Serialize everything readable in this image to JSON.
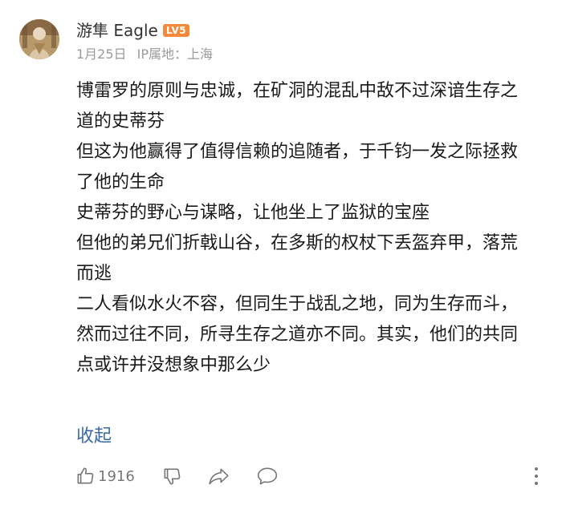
{
  "comment": {
    "username": "游隼 Eagle",
    "level_badge": "LV5",
    "date": "1月25日",
    "ip_location": "IP属地：上海",
    "paragraphs": [
      "博雷罗的原则与忠诚，在矿洞的混乱中敌不过深谙生存之道的史蒂芬",
      "但这为他赢得了值得信赖的追随者，于千钧一发之际拯救了他的生命",
      "史蒂芬的野心与谋略，让他坐上了监狱的宝座",
      "但他的弟兄们折戟山谷，在多斯的权杖下丢盔弃甲，落荒而逃",
      "二人看似水火不容，但同生于战乱之地，同为生存而斗，然而过往不同，所寻生存之道亦不同。其实，他们的共同点或许并没想象中那么少"
    ],
    "collapse_label": "收起",
    "like_count": "1916"
  },
  "icons": {
    "like": "thumbs-up-icon",
    "dislike": "thumbs-down-icon",
    "share": "share-icon",
    "reply": "comment-icon",
    "more": "more-vertical-icon"
  },
  "colors": {
    "badge": "#f5893a",
    "link": "#3b6aa0",
    "meta": "#9a9a9a",
    "text": "#1a1a1a"
  }
}
